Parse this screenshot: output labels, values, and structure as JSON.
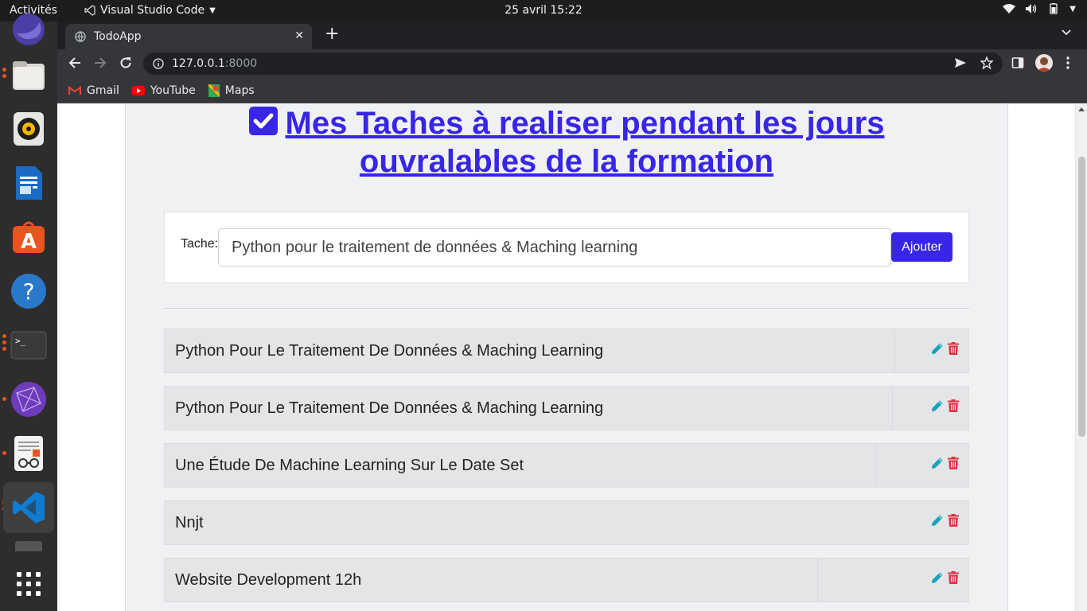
{
  "system_bar": {
    "activities": "Activités",
    "app_name": "Visual Studio Code",
    "clock": "25 avril  15:22"
  },
  "dock": {
    "items": [
      "firefox-icon",
      "files-icon",
      "rhythmbox-icon",
      "libreoffice-writer-icon",
      "software-center-icon",
      "help-icon",
      "terminal-icon",
      "network-icon",
      "text-editor-icon",
      "vscode-icon",
      "show-apps-icon"
    ]
  },
  "browser": {
    "tab_title": "TodoApp",
    "url_host": "127.0.0.1",
    "url_port": ":8000",
    "bookmarks": [
      "Gmail",
      "YouTube",
      "Maps"
    ]
  },
  "page": {
    "heading": "Mes Taches à realiser pendant les jours ouvralables de la formation",
    "form": {
      "label": "Tache:",
      "input_value": "Python pour le traitement de données & Maching learning",
      "submit_label": "Ajouter"
    },
    "tasks": [
      "Python Pour Le Traitement De Données & Maching Learning",
      "Python Pour Le Traitement De Données & Maching Learning",
      "Une Étude De Machine Learning Sur Le Date Set",
      "Nnjt",
      "Website Development 12h"
    ]
  },
  "colors": {
    "accent": "#3826e6",
    "edit_icon": "#17a2b8",
    "delete_icon": "#dc3545"
  }
}
